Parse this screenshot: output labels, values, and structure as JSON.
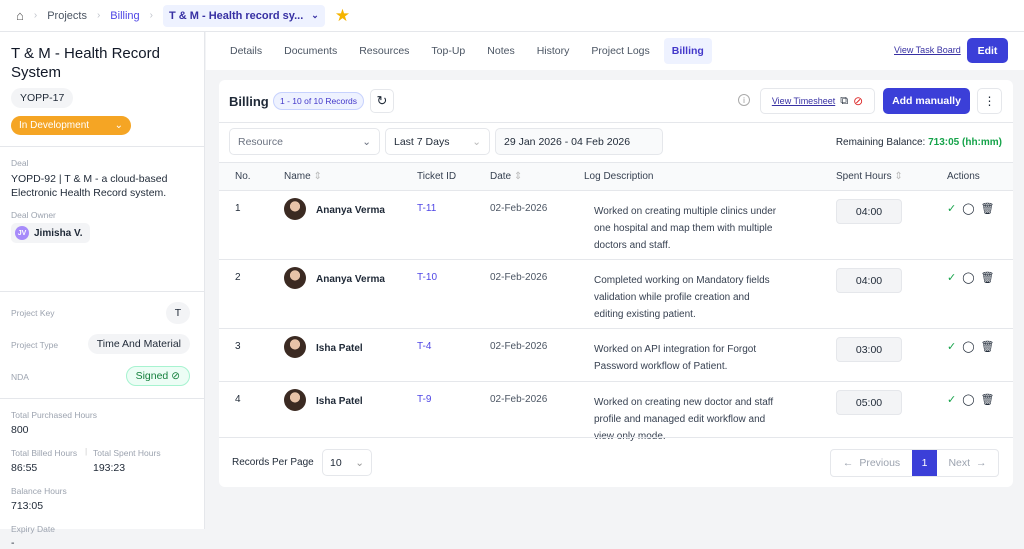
{
  "breadcrumb": {
    "items": [
      "Projects",
      "Billing"
    ],
    "current": "T & M - Health record sy..."
  },
  "project": {
    "title": "T & M - Health Record System",
    "code": "YOPP-17",
    "status": "In Development",
    "deal_label": "Deal",
    "deal": "YOPD-92 | T & M - a cloud-based Electronic Health Record system.",
    "owner_label": "Deal Owner",
    "owner_initials": "JV",
    "owner": "Jimisha V.",
    "key_label": "Project Key",
    "key": "T",
    "type_label": "Project Type",
    "type": "Time And Material",
    "nda_label": "NDA",
    "nda": "Signed",
    "purchased_label": "Total Purchased Hours",
    "purchased": "800",
    "billed_label": "Total Billed Hours",
    "billed": "86:55",
    "spent_label": "Total Spent Hours",
    "spent": "193:23",
    "balance_label": "Balance Hours",
    "balance": "713:05",
    "expiry_label": "Expiry Date",
    "expiry": "-"
  },
  "tabs": [
    "Details",
    "Documents",
    "Resources",
    "Top-Up",
    "Notes",
    "History",
    "Project Logs",
    "Billing"
  ],
  "view_task_board": "View Task Board",
  "edit": "Edit",
  "billing": {
    "title": "Billing",
    "records": "1 - 10 of 10 Records",
    "view_timesheet": "View Timesheet",
    "add": "Add manually",
    "resource_placeholder": "Resource",
    "range": "Last 7 Days",
    "dates": "29 Jan 2026 - 04 Feb 2026",
    "remaining_label": "Remaining Balance:",
    "remaining": "713:05 (hh:mm)",
    "accent": "#3b3fd8",
    "green": "#16a34a"
  },
  "columns": [
    "No.",
    "Name",
    "Ticket ID",
    "Date",
    "Log Description",
    "Spent Hours",
    "Actions"
  ],
  "rows": [
    {
      "no": "1",
      "name": "Ananya Verma",
      "ticket": "T-11",
      "date": "02-Feb-2026",
      "desc": [
        "Worked on creating multiple clinics under",
        "one hospital and map them with multiple",
        "doctors and staff."
      ],
      "hours": "04:00"
    },
    {
      "no": "2",
      "name": "Ananya Verma",
      "ticket": "T-10",
      "date": "02-Feb-2026",
      "desc": [
        "Completed working on Mandatory fields",
        "validation while profile creation and",
        "editing existing patient."
      ],
      "hours": "04:00"
    },
    {
      "no": "3",
      "name": "Isha Patel",
      "ticket": "T-4",
      "date": "02-Feb-2026",
      "desc": [
        "Worked on API integration for Forgot",
        "Password workflow of Patient."
      ],
      "hours": "03:00"
    },
    {
      "no": "4",
      "name": "Isha Patel",
      "ticket": "T-9",
      "date": "02-Feb-2026",
      "desc": [
        "Worked on creating new doctor and staff",
        "profile and managed edit workflow and",
        "view only mode."
      ],
      "hours": "05:00"
    }
  ],
  "footer": {
    "per_page_label": "Records Per Page",
    "per_page": "10",
    "previous": "Previous",
    "page": "1",
    "next": "Next"
  }
}
